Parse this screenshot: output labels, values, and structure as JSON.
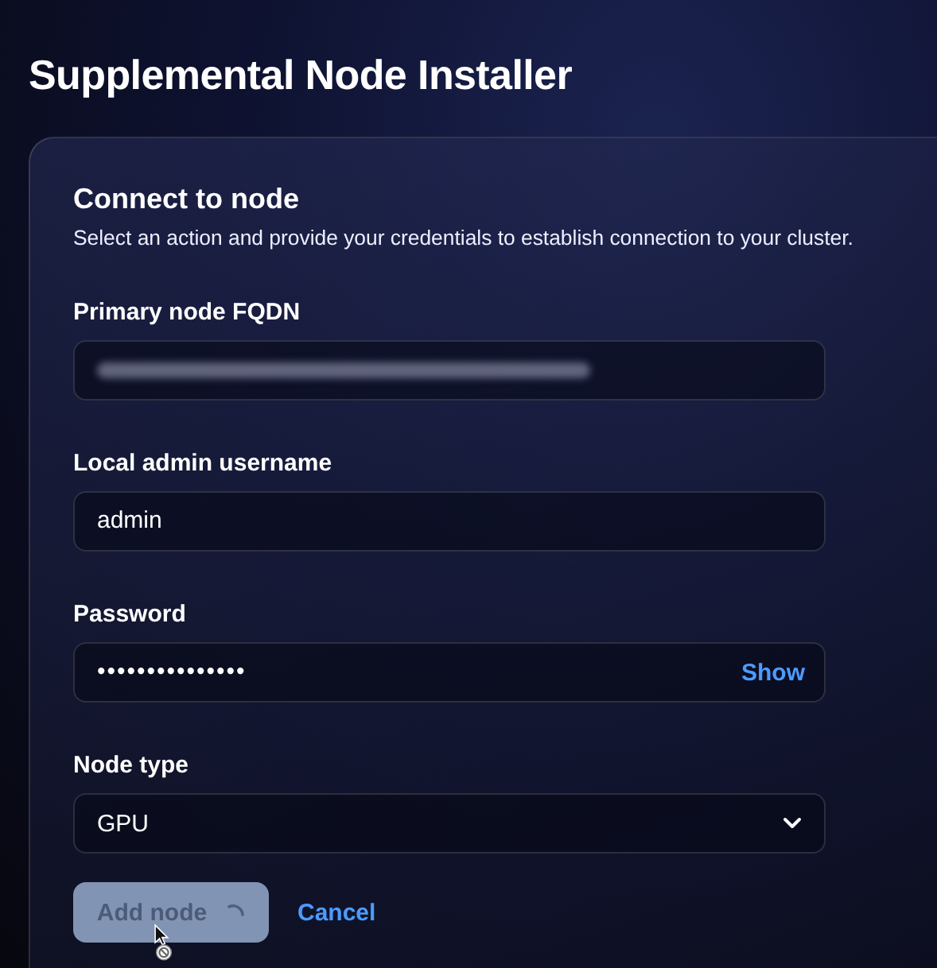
{
  "page": {
    "title": "Supplemental Node Installer"
  },
  "card": {
    "title": "Connect to node",
    "description": "Select an action and provide your credentials to establish connection to your cluster.",
    "fields": [
      {
        "kind": "text",
        "label": "Primary node FQDN",
        "redacted": true
      },
      {
        "kind": "text",
        "label": "Local admin username",
        "value": "admin"
      },
      {
        "kind": "password",
        "label": "Password",
        "value": "•••••••••••••••",
        "toggle": "Show"
      },
      {
        "kind": "select",
        "label": "Node type",
        "value": "GPU"
      }
    ],
    "actions": {
      "primary": {
        "label": "Add node",
        "disabled": true,
        "loading": true
      },
      "secondary": {
        "label": "Cancel"
      }
    }
  }
}
